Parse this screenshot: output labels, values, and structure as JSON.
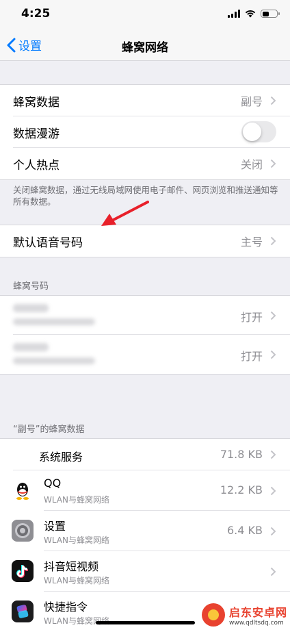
{
  "status": {
    "time": "4:25"
  },
  "nav": {
    "back_label": "设置",
    "title": "蜂窝网络"
  },
  "group1": {
    "cellular_data": {
      "label": "蜂窝数据",
      "value": "副号"
    },
    "roaming": {
      "label": "数据漫游",
      "on": false
    },
    "hotspot": {
      "label": "个人热点",
      "value": "关闭"
    }
  },
  "footnote": "关闭蜂窝数据，通过无线局域网使用电子邮件、网页浏览和推送通知等所有数据。",
  "default_voice": {
    "label": "默认语音号码",
    "value": "主号"
  },
  "numbers_section": {
    "header": "蜂窝号码",
    "rows": [
      {
        "value": "打开"
      },
      {
        "value": "打开"
      }
    ]
  },
  "usage_section": {
    "header": "“副号”的蜂窝数据",
    "system": {
      "name": "系统服务",
      "value": "71.8 KB"
    },
    "apps": [
      {
        "name": "QQ",
        "sub": "WLAN与蜂窝网络",
        "value": "12.2 KB",
        "icon": "qq-icon"
      },
      {
        "name": "设置",
        "sub": "WLAN与蜂窝网络",
        "value": "6.4 KB",
        "icon": "settings-gear-icon"
      },
      {
        "name": "抖音短视频",
        "sub": "WLAN与蜂窝网络",
        "value": "",
        "icon": "douyin-icon"
      },
      {
        "name": "快捷指令",
        "sub": "WLAN与蜂窝网络",
        "value": "",
        "icon": "shortcuts-icon"
      }
    ]
  },
  "watermark": {
    "title": "启东安卓网",
    "url": "www.qdltsdq.com"
  },
  "colors": {
    "accent": "#007aff",
    "annotation": "#e8202a"
  }
}
